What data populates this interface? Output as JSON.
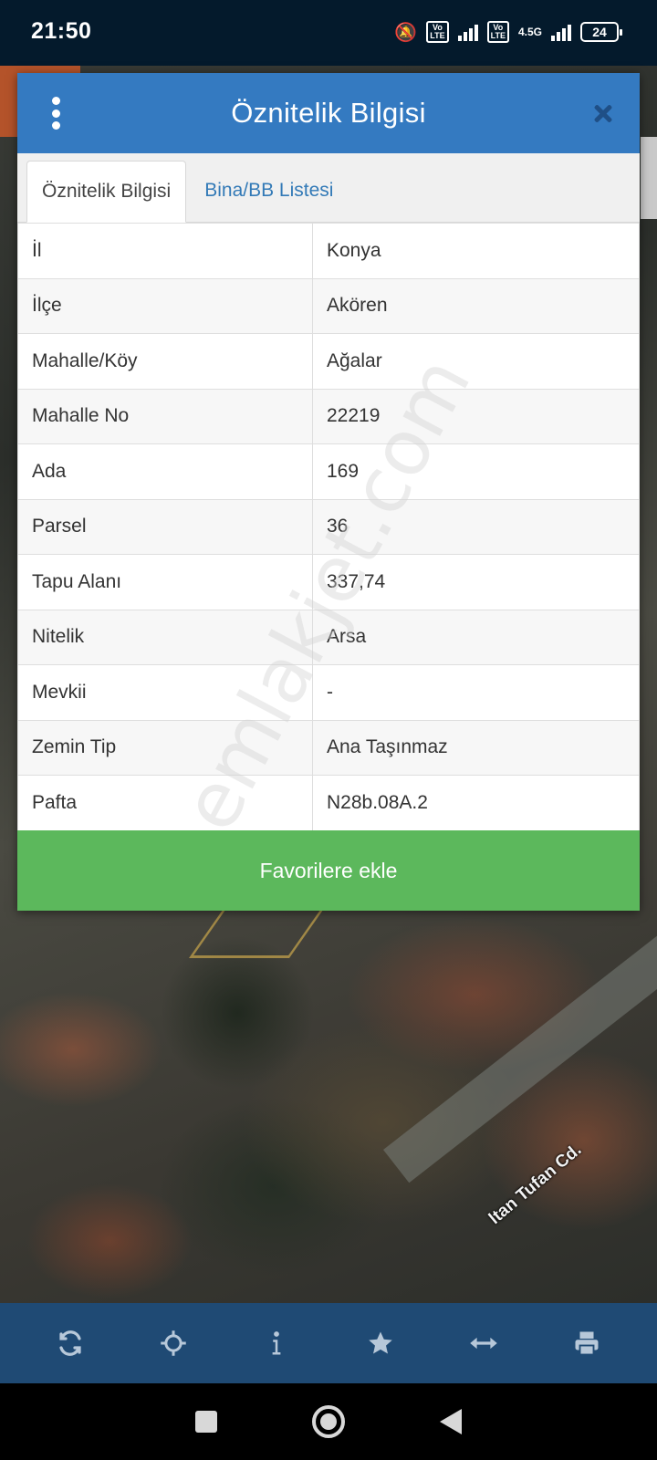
{
  "status_bar": {
    "time": "21:50",
    "network_label": "4.5G",
    "volte_label": "Vo LTE",
    "battery": "24"
  },
  "map": {
    "street_label": "ltan Tufan Cd."
  },
  "watermark": "emlakjet.com",
  "dialog": {
    "title": "Öznitelik Bilgisi",
    "tabs": [
      {
        "label": "Öznitelik Bilgisi",
        "active": true
      },
      {
        "label": "Bina/BB Listesi",
        "active": false
      }
    ],
    "rows": [
      {
        "key": "İl",
        "value": "Konya"
      },
      {
        "key": "İlçe",
        "value": "Akören"
      },
      {
        "key": "Mahalle/Köy",
        "value": "Ağalar"
      },
      {
        "key": "Mahalle No",
        "value": "22219"
      },
      {
        "key": "Ada",
        "value": "169"
      },
      {
        "key": "Parsel",
        "value": "36"
      },
      {
        "key": "Tapu Alanı",
        "value": "337,74"
      },
      {
        "key": "Nitelik",
        "value": "Arsa"
      },
      {
        "key": "Mevkii",
        "value": "-"
      },
      {
        "key": "Zemin Tip",
        "value": "Ana Taşınmaz"
      },
      {
        "key": "Pafta",
        "value": "N28b.08A.2"
      }
    ],
    "favorite_button": "Favorilere ekle"
  },
  "toolbar": {
    "icons": [
      "refresh-icon",
      "locate-icon",
      "info-icon",
      "star-icon",
      "measure-icon",
      "print-icon"
    ]
  },
  "colors": {
    "header": "#347ac1",
    "favorite": "#5cb85c",
    "toolbar": "#1f4a74",
    "status_bar": "#041a2c"
  }
}
